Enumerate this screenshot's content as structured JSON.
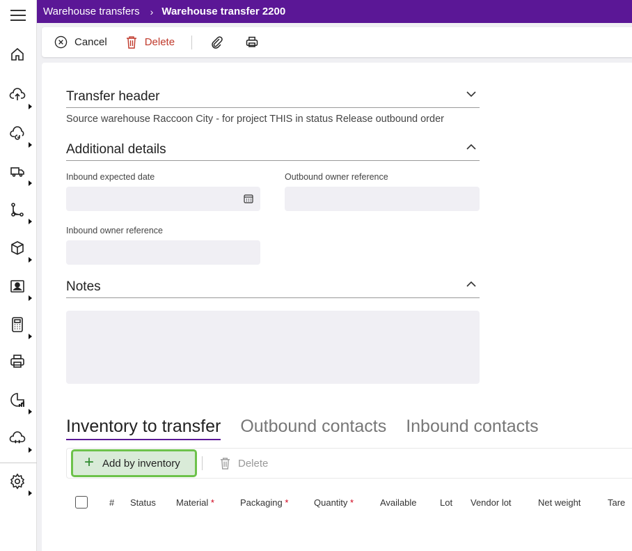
{
  "breadcrumb": {
    "parent": "Warehouse transfers",
    "current": "Warehouse transfer 2200"
  },
  "toolbar": {
    "cancel_label": "Cancel",
    "delete_label": "Delete"
  },
  "transfer_header": {
    "title": "Transfer header",
    "summary": "Source warehouse Raccoon City - for project THIS in status Release outbound order"
  },
  "additional_details": {
    "title": "Additional details",
    "inbound_expected_date_label": "Inbound expected date",
    "inbound_expected_date_value": "",
    "outbound_owner_reference_label": "Outbound owner reference",
    "outbound_owner_reference_value": "",
    "inbound_owner_reference_label": "Inbound owner reference",
    "inbound_owner_reference_value": ""
  },
  "notes": {
    "title": "Notes",
    "value": ""
  },
  "tabs": [
    {
      "label": "Inventory to transfer",
      "active": true
    },
    {
      "label": "Outbound contacts",
      "active": false
    },
    {
      "label": "Inbound contacts",
      "active": false
    }
  ],
  "grid_toolbar": {
    "add_label": "Add by inventory",
    "delete_label": "Delete"
  },
  "grid": {
    "columns": [
      {
        "label": "#",
        "required": false
      },
      {
        "label": "Status",
        "required": false
      },
      {
        "label": "Material",
        "required": true
      },
      {
        "label": "Packaging",
        "required": true
      },
      {
        "label": "Quantity",
        "required": true
      },
      {
        "label": "Available",
        "required": false
      },
      {
        "label": "Lot",
        "required": false
      },
      {
        "label": "Vendor lot",
        "required": false
      },
      {
        "label": "Net weight",
        "required": false
      },
      {
        "label": "Tare",
        "required": false
      }
    ],
    "required_marker": "*"
  },
  "colors": {
    "brand": "#5b1796",
    "highlight_border": "#6dc24b",
    "highlight_fill": "#d9ebd8",
    "danger": "#c0392b"
  },
  "icons": {
    "rail": [
      "menu-icon",
      "home-icon",
      "upload-icon",
      "cloud-sync-icon",
      "truck-icon",
      "workflow-icon",
      "box-icon",
      "id-card-icon",
      "calculator-icon",
      "printer-icon",
      "report-chart-icon",
      "cloud-transfer-icon",
      "settings-icon"
    ]
  }
}
